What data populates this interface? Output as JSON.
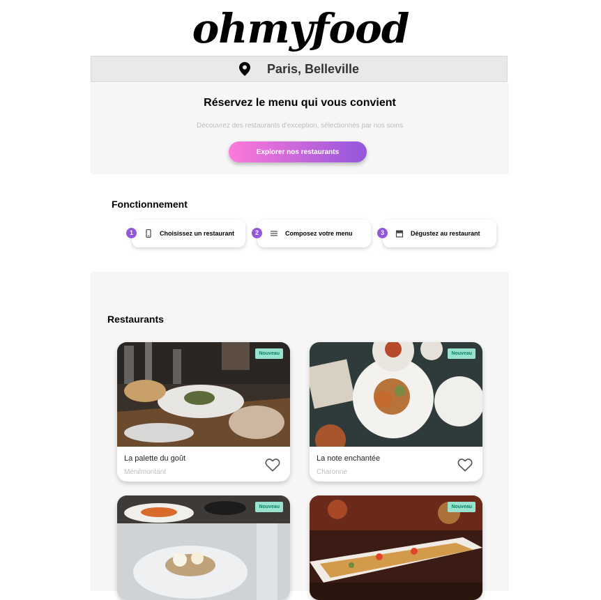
{
  "brand": {
    "logo_text": "ohmyfood"
  },
  "location": {
    "city": "Paris, Belleville",
    "icon": "map-pin-icon"
  },
  "hero": {
    "title": "Réservez le menu qui vous convient",
    "subtitle": "Découvrez des restaurants d'exception, sélectionnés par nos soins",
    "cta_label": "Explorer nos restaurants"
  },
  "how_it_works": {
    "title": "Fonctionnement",
    "steps": [
      {
        "number": "1",
        "label": "Choisissez un restaurant",
        "icon": "mobile-phone-icon"
      },
      {
        "number": "2",
        "label": "Composez votre menu",
        "icon": "menu-list-icon"
      },
      {
        "number": "3",
        "label": "Dégustez au restaurant",
        "icon": "storefront-icon"
      }
    ]
  },
  "restaurants": {
    "title": "Restaurants",
    "badge_label": "Nouveau",
    "items": [
      {
        "name": "La palette du goût",
        "district": "Ménilmontant",
        "badge": "Nouveau"
      },
      {
        "name": "La note enchantée",
        "district": "Charonne",
        "badge": "Nouveau"
      },
      {
        "name": "",
        "district": "",
        "badge": "Nouveau"
      },
      {
        "name": "",
        "district": "",
        "badge": "Nouveau"
      }
    ]
  },
  "colors": {
    "accent_purple": "#9356dc",
    "accent_pink": "#ff79da",
    "badge_bg": "#99e2d0",
    "badge_text": "#008766",
    "section_bg": "#f6f6f6"
  }
}
